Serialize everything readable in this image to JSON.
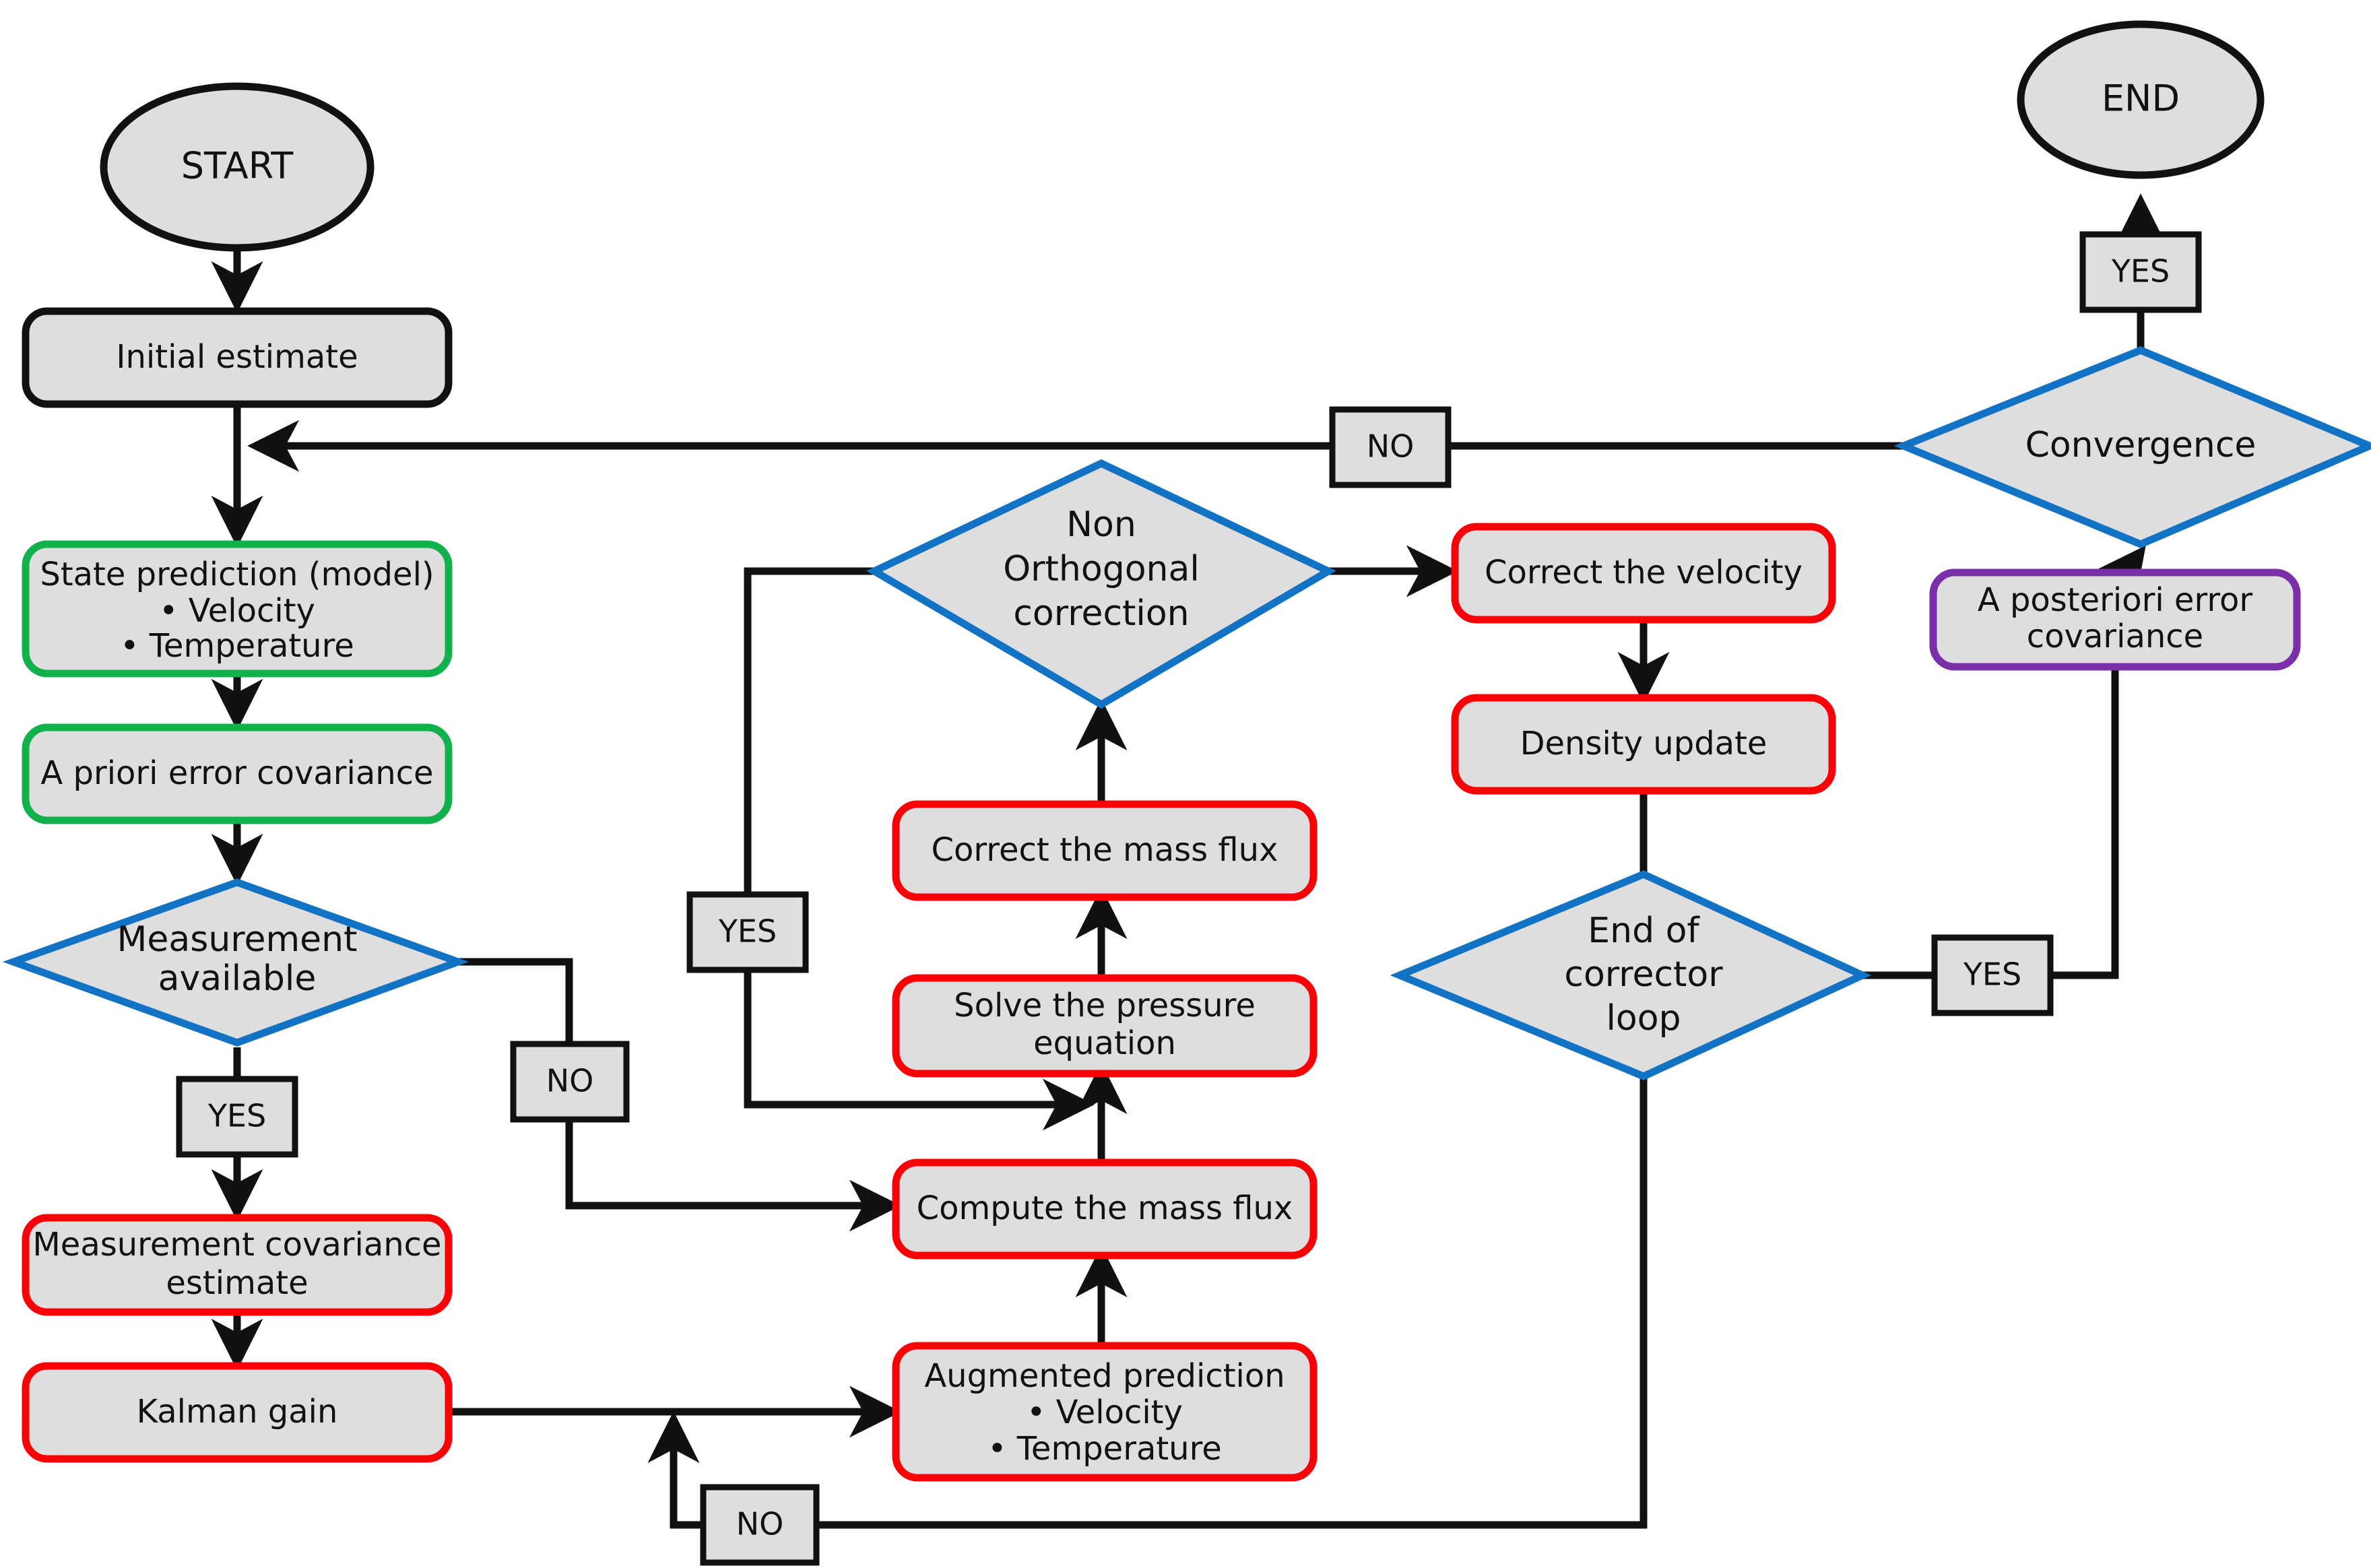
{
  "diagram": {
    "title": "Kalman filter coupled CFD corrector flowchart",
    "colors": {
      "node_fill": "#dedede",
      "black": "#111111",
      "green": "#11b14c",
      "blue": "#1273c4",
      "red": "#fb0007",
      "purple": "#7b2fa8",
      "background": "#ffffff"
    },
    "nodes": {
      "start": {
        "label": "START",
        "shape": "ellipse",
        "border": "black"
      },
      "initial_estimate": {
        "label": "Initial estimate",
        "shape": "rounded-rect",
        "border": "black"
      },
      "state_prediction": {
        "label": "State prediction (model)",
        "bullets": [
          "•      Velocity",
          "•    Temperature"
        ],
        "bullet1": "•      Velocity",
        "bullet2": "•    Temperature",
        "shape": "rounded-rect",
        "border": "green"
      },
      "a_priori": {
        "label": "A priori error covariance",
        "shape": "rounded-rect",
        "border": "green"
      },
      "measurement_available": {
        "line1": "Measurement",
        "line2": "available",
        "shape": "diamond",
        "border": "blue"
      },
      "measurement_covariance": {
        "line1": "Measurement covariance",
        "line2": "estimate",
        "shape": "rounded-rect",
        "border": "red"
      },
      "kalman_gain": {
        "label": "Kalman gain",
        "shape": "rounded-rect",
        "border": "red"
      },
      "augmented_prediction": {
        "label": "Augmented prediction",
        "bullet1": "• Velocity",
        "bullet2": "• Temperature",
        "shape": "rounded-rect",
        "border": "red"
      },
      "compute_mass_flux": {
        "label": "Compute the mass flux",
        "shape": "rounded-rect",
        "border": "red"
      },
      "solve_pressure": {
        "line1": "Solve the pressure",
        "line2": "equation",
        "shape": "rounded-rect",
        "border": "red"
      },
      "correct_mass_flux": {
        "label": "Correct the mass flux",
        "shape": "rounded-rect",
        "border": "red"
      },
      "non_orthogonal": {
        "line1": "Non",
        "line2": "Orthogonal",
        "line3": "correction",
        "shape": "diamond",
        "border": "blue"
      },
      "correct_velocity": {
        "label": "Correct the velocity",
        "shape": "rounded-rect",
        "border": "red"
      },
      "density_update": {
        "label": "Density update",
        "shape": "rounded-rect",
        "border": "red"
      },
      "end_corrector_loop": {
        "line1": "End of",
        "line2": "corrector",
        "line3": "loop",
        "shape": "diamond",
        "border": "blue"
      },
      "a_posteriori": {
        "line1": "A posteriori error",
        "line2": "covariance",
        "shape": "rounded-rect",
        "border": "purple"
      },
      "convergence": {
        "label": "Convergence",
        "shape": "diamond",
        "border": "blue"
      },
      "end": {
        "label": "END",
        "shape": "ellipse",
        "border": "black"
      }
    },
    "edge_labels": {
      "convergence_no": "NO",
      "convergence_yes": "YES",
      "measurement_yes": "YES",
      "measurement_no": "NO",
      "non_orthogonal_yes": "YES",
      "corrector_loop_yes": "YES",
      "corrector_loop_no": "NO"
    }
  }
}
